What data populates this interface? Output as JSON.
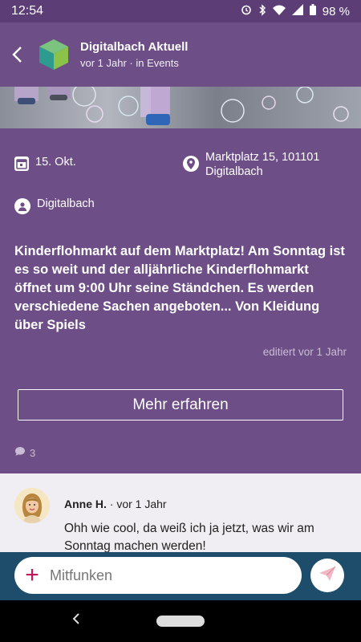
{
  "status": {
    "time": "12:54",
    "battery": "98 %"
  },
  "app": {
    "title": "Digitalbach Aktuell",
    "subtitle": "vor 1 Jahr · in Events"
  },
  "event": {
    "date": "15. Okt.",
    "location_line1": "Marktplatz 15, 101101",
    "location_line2": "Digitalbach",
    "organizer": "Digitalbach",
    "description": "Kinderflohmarkt auf dem Marktplatz! Am Sonntag ist es so weit und der alljährliche Kinderflohmarkt öffnet um 9:00 Uhr seine Ständchen. Es werden verschiedene Sachen angeboten... Von Kleidung über Spiels",
    "edited": "editiert vor 1 Jahr",
    "more_button": "Mehr erfahren",
    "comment_count": "3"
  },
  "comment": {
    "author": "Anne H.",
    "time": " · vor 1 Jahr",
    "text": "Ohh wie cool, da weiß ich ja jetzt, was wir am Sonntag machen werden!"
  },
  "composer": {
    "placeholder": "Mitfunken",
    "plus": "+"
  },
  "colors": {
    "purple": "#6d4e86",
    "input_bar": "#1e4d6b",
    "accent": "#c2185b"
  },
  "icons": [
    "back-arrow-icon",
    "calendar-icon",
    "location-pin-icon",
    "person-icon",
    "comment-bubble-icon",
    "plus-icon",
    "send-icon"
  ]
}
